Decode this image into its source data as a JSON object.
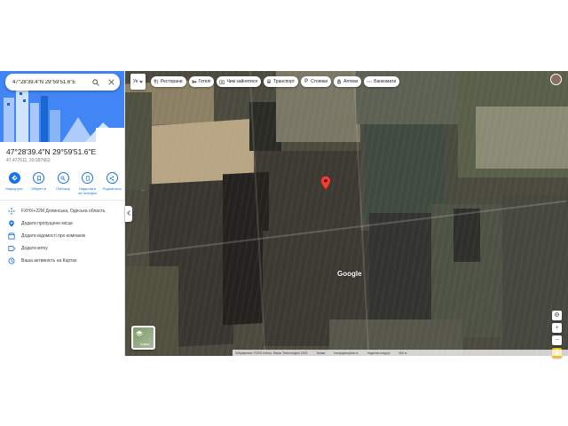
{
  "search": {
    "query": "47°28'39.4\"N 29°59'51.6\"E"
  },
  "place": {
    "title": "47°28'39.4\"N 29°59'51.6\"E",
    "decimal": "47.477611, 29.997662"
  },
  "actions": [
    {
      "label": "Маршрути",
      "icon": "directions-icon"
    },
    {
      "label": "Зберегти",
      "icon": "bookmark-icon"
    },
    {
      "label": "Поблизу",
      "icon": "nearby-icon"
    },
    {
      "label": "Надіслати на телефон",
      "icon": "send-to-phone-icon"
    },
    {
      "label": "Поділитися",
      "icon": "share-icon"
    }
  ],
  "details": [
    {
      "text": "FXHX+22M Долинська, Одеська область",
      "icon": "plus-code-icon"
    },
    {
      "text": "Додати пропущене місце",
      "icon": "add-place-icon"
    },
    {
      "text": "Додати відомості про компанію",
      "icon": "business-icon"
    },
    {
      "text": "Додати мітку",
      "icon": "label-icon"
    },
    {
      "text": "Ваша активність на Картах",
      "icon": "history-icon"
    }
  ],
  "map": {
    "lang_selector": "Ук",
    "chips": [
      {
        "label": "Ресторани",
        "icon": "restaurant-icon"
      },
      {
        "label": "Готелі",
        "icon": "hotel-icon"
      },
      {
        "label": "Чим зайнятися",
        "icon": "attractions-icon"
      },
      {
        "label": "Транспорт",
        "icon": "transit-icon"
      },
      {
        "label": "Стоянки",
        "icon": "parking-icon"
      },
      {
        "label": "Аптеки",
        "icon": "pharmacy-icon"
      },
      {
        "label": "Банкомати",
        "icon": "atm-icon"
      }
    ],
    "layers_label": "Шари",
    "logo": "Google",
    "bottom_bar": [
      "Зображення ©2023 Airbus, Maxar Technologies 2023",
      "Умови",
      "Конфіденційність",
      "Надіслати відгук",
      "500 м"
    ],
    "colors": {
      "accent": "#1a73e8",
      "pin": "#ea4335"
    }
  }
}
